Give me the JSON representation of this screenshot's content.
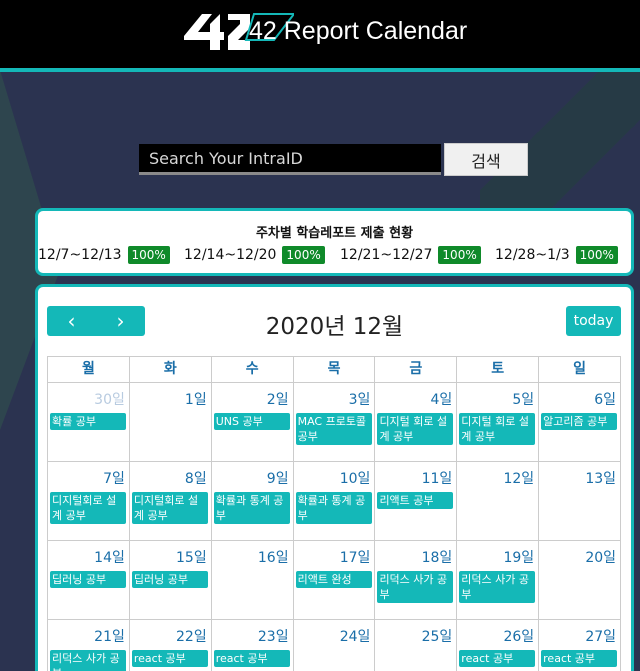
{
  "header": {
    "title": "42 Report Calendar",
    "logo_text": "42"
  },
  "search": {
    "placeholder": "Search Your IntraID",
    "button_label": "검색"
  },
  "report": {
    "title": "주차별 학습레포트 제출 현황",
    "weeks": [
      {
        "range": "12/7~12/13",
        "percent": "100%"
      },
      {
        "range": "12/14~12/20",
        "percent": "100%"
      },
      {
        "range": "12/21~12/27",
        "percent": "100%"
      },
      {
        "range": "12/28~1/3",
        "percent": "100%"
      }
    ]
  },
  "calendar": {
    "title": "2020년 12월",
    "prev_icon": "‹",
    "next_icon": "›",
    "today_label": "today",
    "weekdays": [
      "월",
      "화",
      "수",
      "목",
      "금",
      "토",
      "일"
    ],
    "weeks": [
      [
        {
          "day": "30일",
          "other": true,
          "event": "확률 공부"
        },
        {
          "day": "1일"
        },
        {
          "day": "2일",
          "event": "UNS 공부"
        },
        {
          "day": "3일",
          "event": "MAC 프로토콜 공부"
        },
        {
          "day": "4일",
          "event": "디지털 회로 설계 공부"
        },
        {
          "day": "5일",
          "event": "디지털 회로 설계 공부"
        },
        {
          "day": "6일",
          "event": "알고리즘 공부"
        }
      ],
      [
        {
          "day": "7일",
          "event": "디지털회로 설계 공부"
        },
        {
          "day": "8일",
          "event": "디지털회로 설계 공부"
        },
        {
          "day": "9일",
          "event": "확률과 통계 공부"
        },
        {
          "day": "10일",
          "event": "확률과 통계 공부"
        },
        {
          "day": "11일",
          "event": "리액트 공부"
        },
        {
          "day": "12일"
        },
        {
          "day": "13일"
        }
      ],
      [
        {
          "day": "14일",
          "event": "딥러닝 공부"
        },
        {
          "day": "15일",
          "event": "딥러닝 공부"
        },
        {
          "day": "16일"
        },
        {
          "day": "17일",
          "event": "리액트 완성"
        },
        {
          "day": "18일",
          "event": "리덕스 사가 공부"
        },
        {
          "day": "19일",
          "event": "리덕스 사가 공부"
        },
        {
          "day": "20일"
        }
      ],
      [
        {
          "day": "21일",
          "event": "리덕스 사가 공부"
        },
        {
          "day": "22일",
          "event": "react 공부"
        },
        {
          "day": "23일",
          "event": "react 공부"
        },
        {
          "day": "24일"
        },
        {
          "day": "25일"
        },
        {
          "day": "26일",
          "event": "react 공부"
        },
        {
          "day": "27일",
          "event": "react 공부"
        }
      ]
    ]
  }
}
